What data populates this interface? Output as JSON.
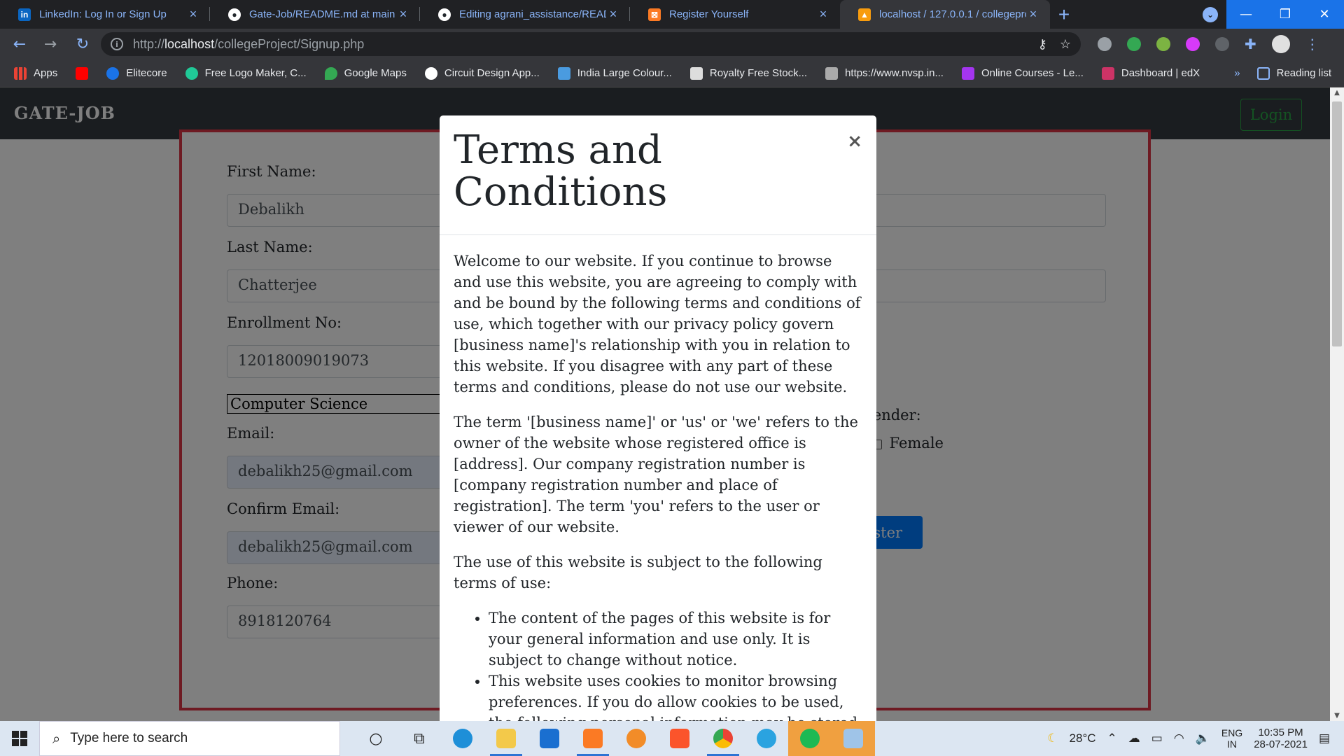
{
  "browser": {
    "tabs": [
      {
        "title": "LinkedIn: Log In or Sign Up",
        "icon": "linkedin-icon",
        "color": "#0a66c2",
        "glyph": "in",
        "active": false
      },
      {
        "title": "Gate-Job/README.md at main · [",
        "icon": "github-icon",
        "color": "#24292e",
        "glyph": "●",
        "active": false
      },
      {
        "title": "Editing agrani_assistance/READM",
        "icon": "github-icon",
        "color": "#24292e",
        "glyph": "●",
        "active": false
      },
      {
        "title": "Register Yourself",
        "icon": "xampp-icon",
        "color": "#fb7a24",
        "glyph": "⊠",
        "active": false
      },
      {
        "title": "localhost / 127.0.0.1 / collegepro",
        "icon": "phpmyadmin-icon",
        "color": "#f89c0e",
        "glyph": "▲",
        "active": true
      }
    ],
    "new_tab": "+",
    "url_prefix": "http://",
    "url_host": "localhost",
    "url_path": "/collegeProject/Signup.php",
    "bookmarks": [
      {
        "label": "Apps",
        "icon": "apps-grid-icon",
        "color": "#4285f4"
      },
      {
        "label": "",
        "icon": "youtube-icon",
        "color": "#ff0000"
      },
      {
        "label": "Elitecore",
        "icon": "elitecore-icon",
        "color": "#1a73e8"
      },
      {
        "label": "Free Logo Maker, C...",
        "icon": "logo-maker-icon",
        "color": "#20c997"
      },
      {
        "label": "Google Maps",
        "icon": "google-maps-icon",
        "color": "#34a853"
      },
      {
        "label": "Circuit Design App...",
        "icon": "circuit-icon",
        "color": "#ffffff"
      },
      {
        "label": "India Large Colour...",
        "icon": "map-icon",
        "color": "#4a9be0"
      },
      {
        "label": "Royalty Free Stock...",
        "icon": "stock-icon",
        "color": "#dddddd"
      },
      {
        "label": "https://www.nvsp.in...",
        "icon": "nvsp-icon",
        "color": "#aaaaaa"
      },
      {
        "label": "Online Courses - Le...",
        "icon": "udemy-icon",
        "color": "#a435f0"
      },
      {
        "label": "Dashboard | edX",
        "icon": "edx-icon",
        "color": "#cc3366"
      }
    ],
    "bookmarks_more": "»",
    "reading_list": "Reading list"
  },
  "site": {
    "brand": "GATE-JOB",
    "login_label": "Login"
  },
  "form": {
    "first_name_label": "First Name:",
    "first_name_value": "Debalikh",
    "last_name_label": "Last Name:",
    "last_name_value": "Chatterjee",
    "enrollment_label": "Enrollment No:",
    "enrollment_value": "12018009019073",
    "department_value": "Computer Science",
    "email_label": "Email:",
    "email_value": "debalikh25@gmail.com",
    "confirm_email_label": "Confirm Email:",
    "confirm_email_value": "debalikh25@gmail.com",
    "phone_label": "Phone:",
    "phone_value": "8918120764",
    "gender_label": "Gender:",
    "gender_male_partial": "le",
    "gender_female": "Female",
    "register_label": "Register"
  },
  "modal": {
    "title": "Terms and Conditions",
    "close": "×",
    "paragraphs": [
      "Welcome to our website. If you continue to browse and use this website, you are agreeing to comply with and be bound by the following terms and conditions of use, which together with our privacy policy govern [business name]'s relationship with you in relation to this website. If you disagree with any part of these terms and conditions, please do not use our website.",
      "The term '[business name]' or 'us' or 'we' refers to the owner of the website whose registered office is [address]. Our company registration number is [company registration number and place of registration]. The term 'you' refers to the user or viewer of our website.",
      "The use of this website is subject to the following terms of use:"
    ],
    "bullets": [
      "The content of the pages of this website is for your general information and use only. It is subject to change without notice.",
      "This website uses cookies to monitor browsing preferences. If you do allow cookies to be used, the following personal information may be stored by us for use by third parties: [insert list of information]."
    ]
  },
  "taskbar": {
    "search_placeholder": "Type here to search",
    "weather": "28°C",
    "lang_top": "ENG",
    "lang_bottom": "IN",
    "time": "10:35 PM",
    "date": "28-07-2021"
  }
}
